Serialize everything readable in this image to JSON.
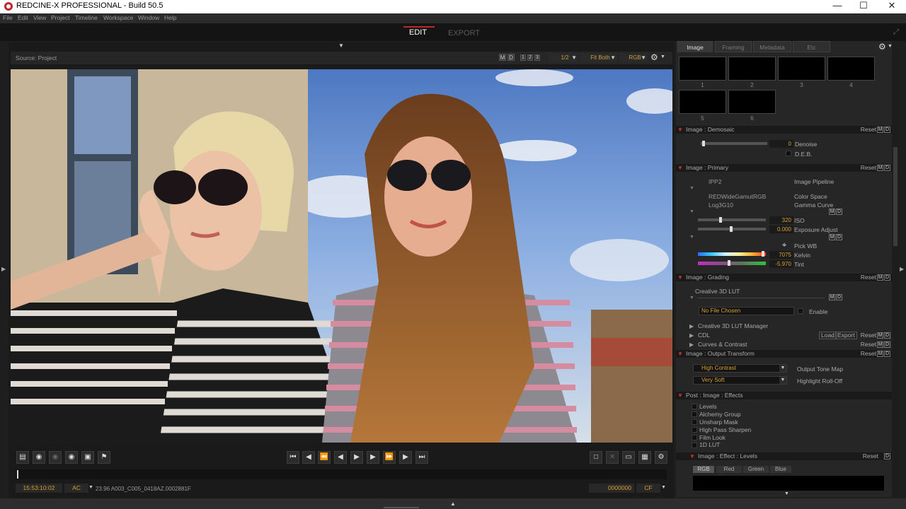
{
  "window": {
    "title": "REDCINE-X PROFESSIONAL - Build 50.5"
  },
  "menu": [
    "File",
    "Edit",
    "View",
    "Project",
    "Timeline",
    "Workspace",
    "Window",
    "Help"
  ],
  "modes": {
    "edit": "EDIT",
    "export": "EXPORT"
  },
  "viewer": {
    "source": "Source: Project",
    "m": "M",
    "d": "D",
    "layouts": [
      "1",
      "2",
      "3"
    ],
    "resolution": "1/2",
    "fit": "Fit Both",
    "channel": "RGB"
  },
  "status": {
    "timecode": "15:53:10:02",
    "tc_mode": "AC",
    "clip": "23.96 A003_C005_0418AZ.0002881F",
    "frame": "0000000",
    "frame_mode": "CF"
  },
  "panel": {
    "tabs": [
      "Image",
      "Framing",
      "Metadata",
      "Etc"
    ],
    "slots": [
      "1",
      "2",
      "3",
      "4",
      "5",
      "6"
    ],
    "reset": "Reset",
    "demosaic": {
      "title": "Image : Demosaic",
      "denoise_value": "0",
      "denoise": "Denoise",
      "deb": "D.E.B."
    },
    "primary": {
      "title": "Image : Primary",
      "pipeline_value": "IPP2",
      "pipeline": "Image Pipeline",
      "colorspace_value": "REDWideGamutRGB",
      "colorspace": "Color Space",
      "gamma_value": "Log3G10",
      "gamma": "Gamma Curve",
      "iso_value": "320",
      "iso": "ISO",
      "exposure_value": "0.000",
      "exposure": "Exposure Adjust",
      "pickwb": "Pick WB",
      "kelvin_value": "7075",
      "kelvin": "Kelvin",
      "tint_value": "-5.970",
      "tint": "Tint"
    },
    "grading": {
      "title": "Image : Grading",
      "lut": "Creative 3D LUT",
      "file": "No File Chosen",
      "enable": "Enable"
    },
    "lut_manager": "Creative 3D LUT Manager",
    "cdl": {
      "title": "CDL",
      "load": "Load",
      "export": "Export"
    },
    "curves": "Curves & Contrast",
    "output": {
      "title": "Image : Output Transform",
      "tone_value": "High Contrast",
      "tone": "Output Tone Map",
      "rolloff_value": "Very Soft",
      "rolloff": "Highlight Roll-Off"
    },
    "effects": {
      "title": "Post : Image : Effects",
      "items": [
        "Levels",
        "Alchemy Group",
        "Unsharp Mask",
        "High Pass Sharpen",
        "Film Look",
        "1D LUT"
      ]
    },
    "levels": {
      "title": "Image : Effect : Levels",
      "channels": [
        "RGB",
        "Red",
        "Green",
        "Blue"
      ]
    }
  }
}
